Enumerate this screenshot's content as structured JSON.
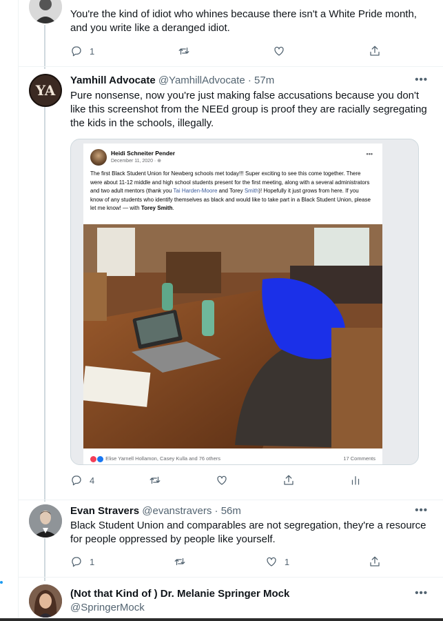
{
  "tweets": [
    {
      "text": "You're the kind of idiot who whines because there isn't a White Pride month, and you write like a deranged idiot.",
      "reply_count": "1"
    },
    {
      "name": "Yamhill Advocate",
      "handle": "@YamhillAdvocate",
      "time": "· 57m",
      "avatar_text": "YA",
      "text": "Pure nonsense, now you're just making false accusations because you don't like this screenshot from the NEEd group is proof they are racially segregating the kids in the schools, illegally.",
      "reply_count": "4",
      "embedded_post": {
        "author": "Heidi Schneiter Pender",
        "date": "December 11, 2020 · ⊕",
        "text_1": "The first Black Student Union for Newberg schools met today!!! Super exciting to see this come together. There were about 11-12 middle and high school students present for the first meeting, along with a several administrators and two adult mentors (thank you ",
        "link_1": "Tai Harden-Moore",
        "text_2": " and Torey ",
        "link_2": "Smith",
        "text_3": ")! Hopefully it just grows from here. If you know of any students who identify themselves as black and would like to take part in a Black Student Union, please let me know! — with ",
        "tagged": "Torey Smith",
        "text_4": ".",
        "reactions": "Elise Yarnell Hollamon, Casey Kulla and 76 others",
        "comments": "17 Comments"
      }
    },
    {
      "name": "Evan Stravers",
      "handle": "@evanstravers",
      "time": "· 56m",
      "text": "Black Student Union and comparables are not segregation, they're a resource for people oppressed by people like yourself.",
      "reply_count": "1",
      "like_count": "1"
    },
    {
      "name": "(Not that Kind of ) Dr. Melanie Springer Mock",
      "handle": "@SpringerMock"
    }
  ],
  "more_label": "•••",
  "icons": [
    "reply-icon",
    "retweet-icon",
    "like-icon",
    "share-icon",
    "analytics-icon",
    "more-icon"
  ],
  "colors": {
    "handle": "#536471",
    "accent": "#1d9bf0",
    "link": "#385898"
  }
}
